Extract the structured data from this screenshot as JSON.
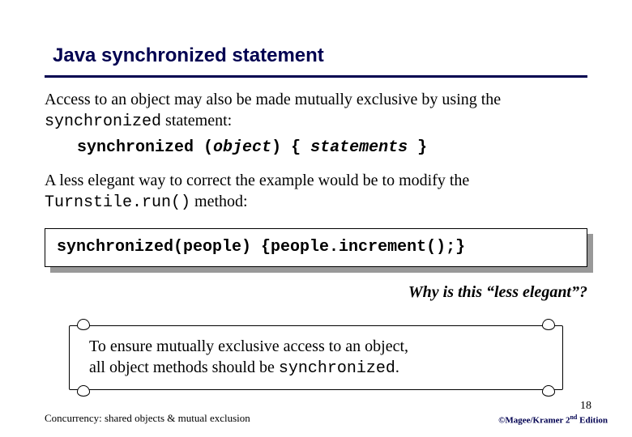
{
  "title": "Java synchronized statement",
  "para1_a": "Access to an object may also be made mutually exclusive by using the ",
  "para1_kw": "synchronized",
  "para1_b": " statement:",
  "syntax_kw": "synchronized ",
  "syntax_p1": "(",
  "syntax_obj": "object",
  "syntax_p2": ")",
  "syntax_brace1": " { ",
  "syntax_stmts": "statements",
  "syntax_brace2": " }",
  "para2_a": "A less elegant way to correct the example would be to modify the ",
  "para2_code": "Turnstile.run()",
  "para2_b": " method:",
  "codebox": "synchronized(people) {people.increment();}",
  "question": "Why is this “less elegant”?",
  "scroll_line1": "To ensure mutually exclusive access to an object,",
  "scroll_line2a": "all object methods should be ",
  "scroll_line2b": "synchronized",
  "scroll_line2c": ".",
  "footer_left": "Concurrency: shared objects & mutual exclusion",
  "page_num": "18",
  "credit_a": "©Magee/Kramer ",
  "credit_b": "2",
  "credit_sup": "nd",
  "credit_c": " Edition"
}
